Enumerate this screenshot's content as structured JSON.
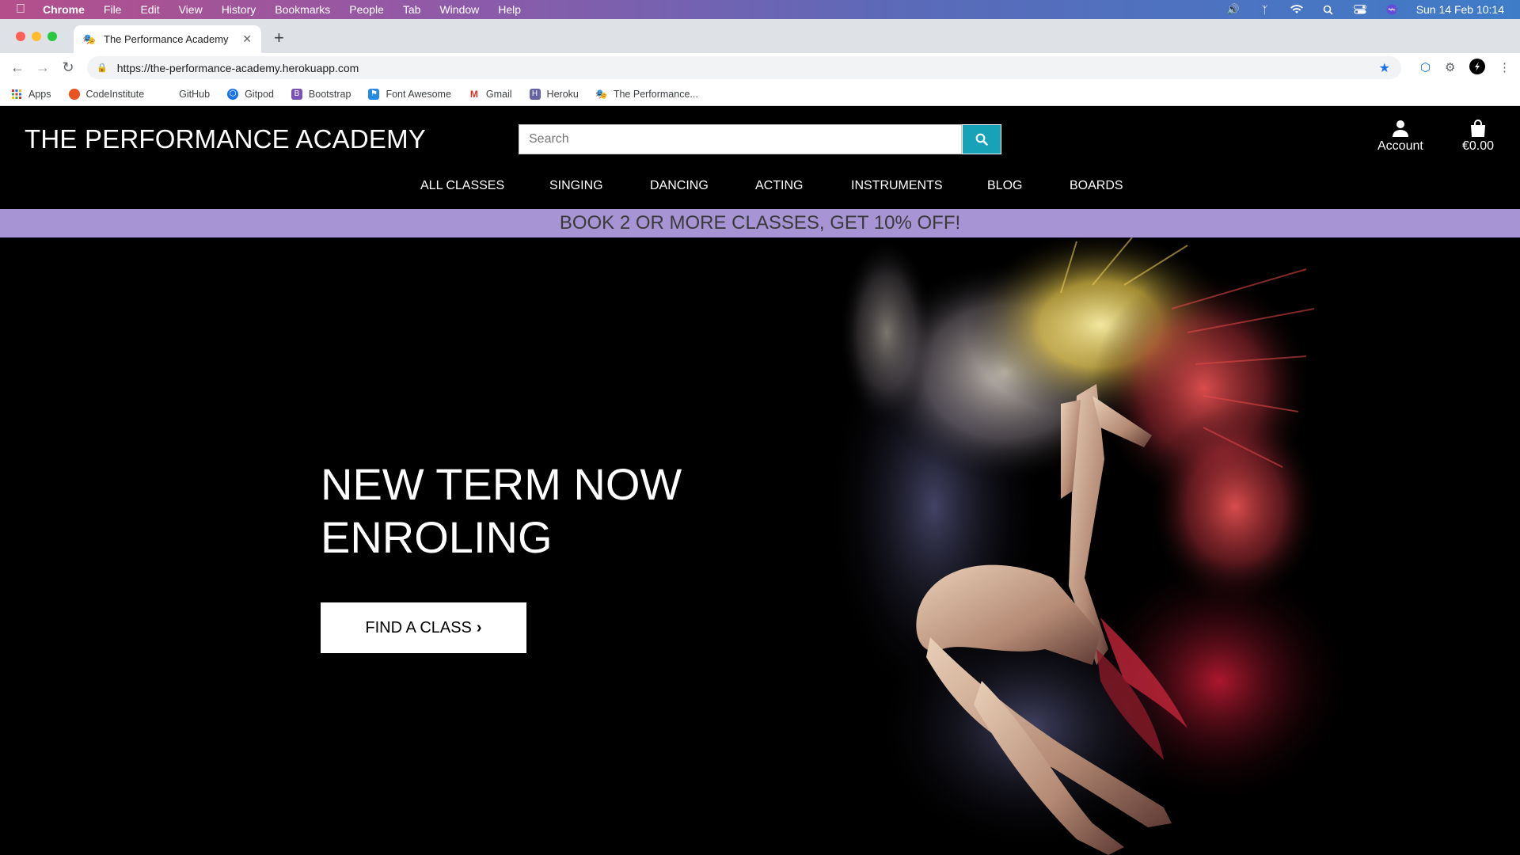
{
  "menubar": {
    "app": "Chrome",
    "items": [
      "File",
      "Edit",
      "View",
      "History",
      "Bookmarks",
      "People",
      "Tab",
      "Window",
      "Help"
    ],
    "datetime": "Sun 14 Feb  10:14"
  },
  "browser": {
    "tab_title": "The Performance Academy",
    "url": "https://the-performance-academy.herokuapp.com",
    "bookmarks": [
      {
        "label": "Apps",
        "icon": "apps-grid-icon"
      },
      {
        "label": "CodeInstitute",
        "icon": "codeinstitute-icon"
      },
      {
        "label": "GitHub",
        "icon": "github-icon"
      },
      {
        "label": "Gitpod",
        "icon": "gitpod-icon"
      },
      {
        "label": "Bootstrap",
        "icon": "bootstrap-icon"
      },
      {
        "label": "Font Awesome",
        "icon": "font-awesome-icon"
      },
      {
        "label": "Gmail",
        "icon": "gmail-icon"
      },
      {
        "label": "Heroku",
        "icon": "heroku-icon"
      },
      {
        "label": "The Performance...",
        "icon": "theatre-masks-icon"
      }
    ]
  },
  "site": {
    "logo": "THE PERFORMANCE ACADEMY",
    "search_placeholder": "Search",
    "account_label": "Account",
    "cart_total": "€0.00",
    "nav": [
      "ALL CLASSES",
      "SINGING",
      "DANCING",
      "ACTING",
      "INSTRUMENTS",
      "BLOG",
      "BOARDS"
    ],
    "banner": "BOOK 2 OR MORE CLASSES, GET 10% OFF!",
    "hero_heading": "NEW TERM NOW ENROLING",
    "hero_button": "FIND A CLASS"
  },
  "colors": {
    "banner_bg": "#a694d4",
    "search_button": "#17a2b8",
    "header_bg": "#000000"
  }
}
